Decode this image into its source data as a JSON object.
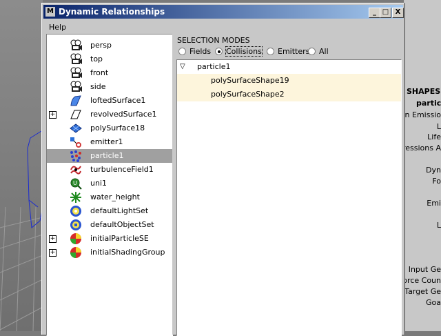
{
  "window": {
    "title": "Dynamic Relationships",
    "app_icon": "M",
    "minimize": "_",
    "maximize": "□",
    "close": "X"
  },
  "menu": {
    "help": "Help"
  },
  "outliner": {
    "items": [
      {
        "label": "persp",
        "icon": "camera-icon",
        "expander": ""
      },
      {
        "label": "top",
        "icon": "camera-icon",
        "expander": ""
      },
      {
        "label": "front",
        "icon": "camera-icon",
        "expander": ""
      },
      {
        "label": "side",
        "icon": "camera-icon",
        "expander": ""
      },
      {
        "label": "loftedSurface1",
        "icon": "nurbs-surface-icon",
        "expander": ""
      },
      {
        "label": "revolvedSurface1",
        "icon": "revolved-surface-icon",
        "expander": "+"
      },
      {
        "label": "polySurface18",
        "icon": "poly-surface-icon",
        "expander": ""
      },
      {
        "label": "emitter1",
        "icon": "emitter-icon",
        "expander": ""
      },
      {
        "label": "particle1",
        "icon": "particle-icon",
        "expander": "",
        "selected": true
      },
      {
        "label": "turbulenceField1",
        "icon": "turbulence-field-icon",
        "expander": ""
      },
      {
        "label": "uni1",
        "icon": "uniform-field-icon",
        "expander": ""
      },
      {
        "label": "water_height",
        "icon": "locator-icon",
        "expander": ""
      },
      {
        "label": "defaultLightSet",
        "icon": "light-set-icon",
        "expander": ""
      },
      {
        "label": "defaultObjectSet",
        "icon": "object-set-icon",
        "expander": ""
      },
      {
        "label": "initialParticleSE",
        "icon": "shading-group-icon",
        "expander": "+"
      },
      {
        "label": "initialShadingGroup",
        "icon": "shading-group-icon",
        "expander": "+"
      }
    ]
  },
  "selection_modes": {
    "title": "SELECTION MODES",
    "options": [
      {
        "label": "Fields",
        "selected": false
      },
      {
        "label": "Collisions",
        "selected": true
      },
      {
        "label": "Emitters",
        "selected": false
      },
      {
        "label": "All",
        "selected": false
      }
    ]
  },
  "relations": {
    "parent": "particle1",
    "expander": "▽",
    "children": [
      "polySurfaceShape19",
      "polySurfaceShape2"
    ]
  },
  "attribute_editor": {
    "header": "SHAPES",
    "node": "particle",
    "labels": [
      "On Emissio",
      "L",
      "Life",
      "pressions A",
      "Dyn",
      "Fo",
      "Emi",
      "L",
      "Input Ge",
      "force Coun",
      "Target Ge",
      "Goa"
    ]
  },
  "colors": {
    "title_start": "#0a246a",
    "title_end": "#a6caf0",
    "selection": "#a0a0a0",
    "relation_highlight": "#fdf5dc"
  }
}
